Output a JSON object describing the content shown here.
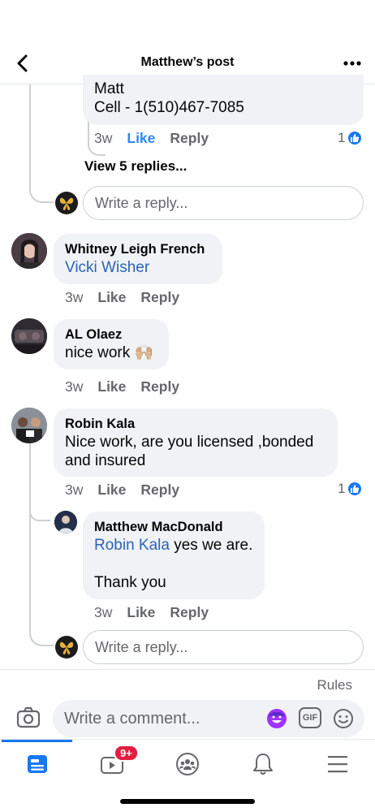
{
  "header": {
    "title": "Matthew’s post"
  },
  "thread": {
    "prev_comment": {
      "lines": [
        "Matt",
        "Cell - 1(510)467-7085"
      ],
      "time": "3w",
      "like": "Like",
      "reply": "Reply",
      "reactions": "1"
    },
    "view_replies": "View 5 replies...",
    "reply_placeholder": "Write a reply..."
  },
  "comments": [
    {
      "author": "Whitney Leigh French",
      "mention": "Vicki Wisher",
      "time": "3w",
      "like": "Like",
      "reply": "Reply"
    },
    {
      "author": "AL Olaez",
      "text": "nice work 🙌🏼",
      "time": "3w",
      "like": "Like",
      "reply": "Reply"
    },
    {
      "author": "Robin Kala",
      "text_line1": "Nice work, are you licensed ,bonded",
      "text_line2": "and insured",
      "time": "3w",
      "like": "Like",
      "reply": "Reply",
      "reactions": "1"
    }
  ],
  "reply": {
    "author": "Matthew MacDonald",
    "mention": "Robin Kala",
    "text_after_mention": " yes we are.",
    "text_line2": "Thank you",
    "time": "3w",
    "like": "Like",
    "reply": "Reply"
  },
  "reply_box_2": {
    "placeholder": "Write a reply..."
  },
  "footer": {
    "rules": "Rules",
    "comment_placeholder": "Write a comment...",
    "gif": "GIF",
    "video_badge": "9+"
  },
  "colors": {
    "accent": "#1877f2",
    "mention": "#2d63b8",
    "bubble": "#f0f2f5",
    "badge": "#e41e3f"
  }
}
